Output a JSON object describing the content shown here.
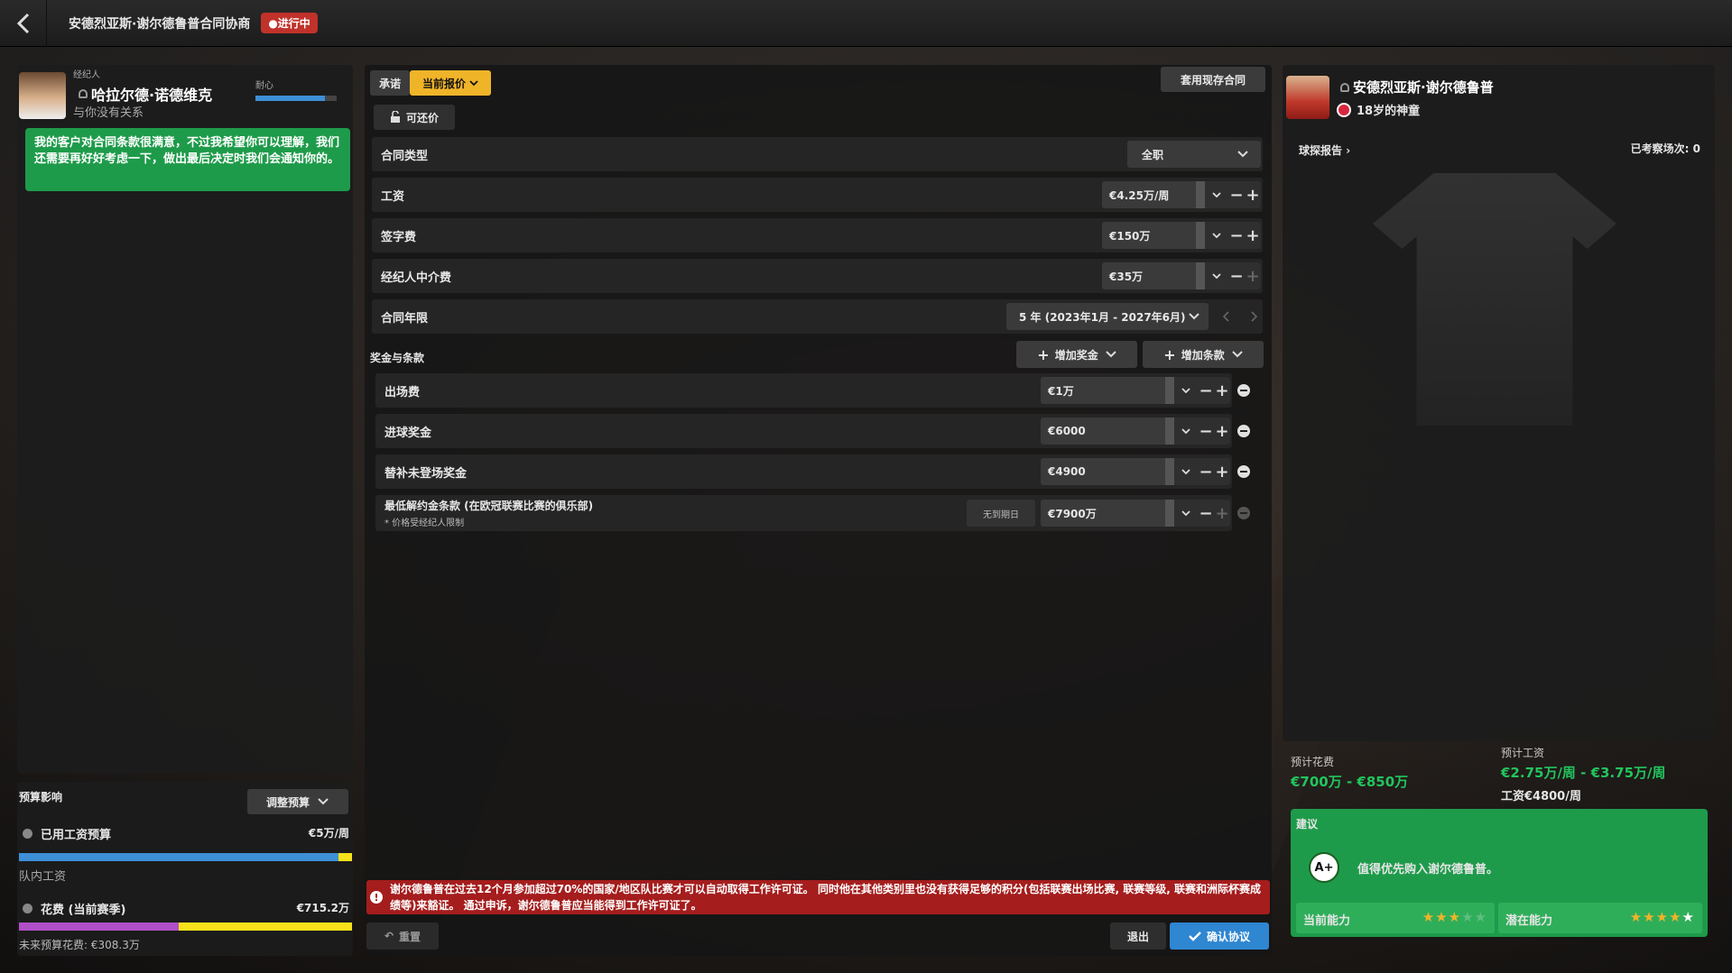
{
  "header": {
    "title": "安德烈亚斯·谢尔德鲁普合同协商",
    "status": "●进行中"
  },
  "agent": {
    "role": "经纪人",
    "name": "哈拉尔德·诺德维克",
    "relation": "与你没有关系",
    "patience_label": "耐心",
    "patience_level": 0.85,
    "message": "我的客户对合同条款很满意，不过我希望你可以理解，我们还需要再好好考虑一下，做出最后决定时我们会通知你的。"
  },
  "budget": {
    "title": "预算影响",
    "adjust_label": "调整预算",
    "wage_label": "已用工资预算",
    "wage_value": "€5万/周",
    "wage_fill": 0.96,
    "team_wage_label": "队内工资",
    "spend_label": "花费 (当前赛季)",
    "spend_value": "€715.2万",
    "spend_purple_fill": 0.48,
    "future_label": "未来预算花费: €308.3万"
  },
  "tabs": {
    "promise": "承诺",
    "current_offer": "当前报价"
  },
  "use_existing_label": "套用现存合同",
  "negotiable_label": "可还价",
  "contract": {
    "type": {
      "label": "合同类型",
      "value": "全职"
    },
    "wage": {
      "label": "工资",
      "value": "€4.25万/周"
    },
    "signing": {
      "label": "签字费",
      "value": "€150万"
    },
    "agent_fee": {
      "label": "经纪人中介费",
      "value": "€35万"
    },
    "length": {
      "label": "合同年限",
      "value": "5 年 (2023年1月 - 2027年6月)"
    }
  },
  "bonuses": {
    "title": "奖金与条款",
    "add_bonus": "增加奖金",
    "add_clause": "增加条款",
    "items": [
      {
        "label": "出场费",
        "value": "€1万"
      },
      {
        "label": "进球奖金",
        "value": "€6000"
      },
      {
        "label": "替补未登场奖金",
        "value": "€4900"
      }
    ],
    "release": {
      "label": "最低解约金条款 (在欧冠联赛比赛的俱乐部)",
      "note": "* 价格受经纪人限制",
      "expiry": "无到期日",
      "value": "€7900万"
    }
  },
  "warning": "谢尔德鲁普在过去12个月参加超过70%的国家/地区队比赛才可以自动取得工作许可证。 同时他在其他类别里也没有获得足够的积分(包括联赛出场比赛, 联赛等级, 联赛和洲际杯赛成绩等)来豁证。 通过申诉，谢尔德鲁普应当能得到工作许可证了。",
  "footer": {
    "reset": "重置",
    "exit": "退出",
    "confirm": "确认协议"
  },
  "player": {
    "name": "安德烈亚斯·谢尔德鲁普",
    "desc": "18岁的神童",
    "scout_report": "球探报告",
    "scouted": "已考察场次: 0",
    "est_fee_label": "预计花费",
    "est_fee": "€700万 - €850万",
    "est_wage_label": "预计工资",
    "est_wage": "€2.75万/周 - €3.75万/周",
    "wage_note": "工资€4800/周"
  },
  "advice": {
    "title": "建议",
    "grade": "A+",
    "text": "值得优先购入谢尔德鲁普。",
    "current_label": "当前能力",
    "current_stars": 3,
    "potential_label": "潜在能力",
    "potential_stars": 5
  },
  "colors": {
    "accent": "#1e9b4a",
    "badge": "#c0322a",
    "confirm": "#2f86d1",
    "gold": "#f0b429"
  }
}
